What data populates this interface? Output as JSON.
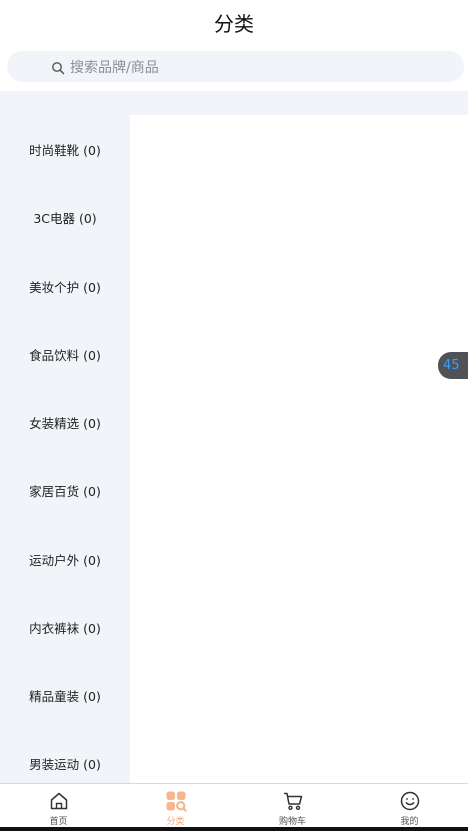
{
  "header": {
    "title": "分类"
  },
  "search": {
    "placeholder": "搜索品牌/商品"
  },
  "sidebar": {
    "items": [
      {
        "label": "时尚鞋靴 (0)"
      },
      {
        "label": "3C电器 (0)"
      },
      {
        "label": "美妆个护 (0)"
      },
      {
        "label": "食品饮料 (0)"
      },
      {
        "label": "女装精选 (0)"
      },
      {
        "label": "家居百货 (0)"
      },
      {
        "label": "运动户外 (0)"
      },
      {
        "label": "内衣裤袜 (0)"
      },
      {
        "label": "精品童装 (0)"
      },
      {
        "label": "男装运动 (0)"
      }
    ]
  },
  "float_badge": {
    "text": "45"
  },
  "tabbar": {
    "tabs": [
      {
        "label": "首页",
        "icon": "home-icon"
      },
      {
        "label": "分类",
        "icon": "category-icon",
        "active": true
      },
      {
        "label": "购物车",
        "icon": "cart-icon"
      },
      {
        "label": "我的",
        "icon": "smile-icon"
      }
    ]
  },
  "colors": {
    "accent": "#f4a67e",
    "sidebar_bg": "#f1f4f8",
    "badge_bg": "#4f5257",
    "badge_text": "#3aa0ff"
  }
}
